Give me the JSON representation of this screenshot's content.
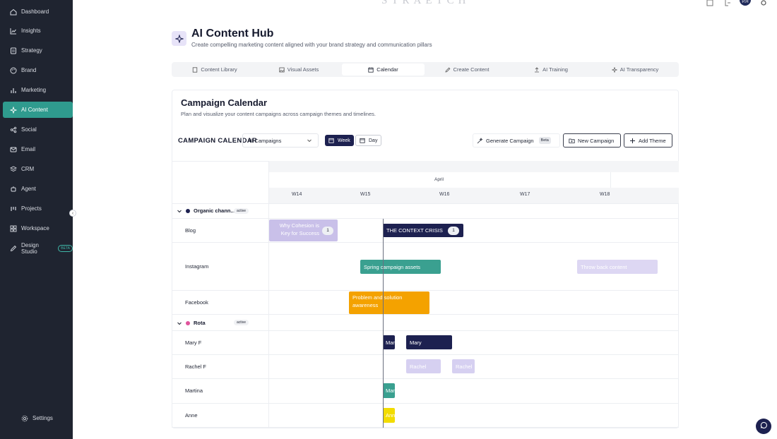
{
  "sidebar": {
    "items": [
      {
        "label": "Dashboard",
        "icon": "home-icon"
      },
      {
        "label": "Insights",
        "icon": "chart-line-icon"
      },
      {
        "label": "Strategy",
        "icon": "document-icon"
      },
      {
        "label": "Brand",
        "icon": "palette-icon"
      },
      {
        "label": "Marketing",
        "icon": "bar-chart-icon"
      },
      {
        "label": "AI Content",
        "icon": "sparkles-icon",
        "active": true
      },
      {
        "label": "Social",
        "icon": "share-icon"
      },
      {
        "label": "Email",
        "icon": "mail-icon"
      },
      {
        "label": "CRM",
        "icon": "crm-icon"
      },
      {
        "label": "Agent",
        "icon": "robot-icon"
      },
      {
        "label": "Projects",
        "icon": "projects-icon"
      },
      {
        "label": "Workspace",
        "icon": "grid-icon"
      },
      {
        "label": "Design Studio",
        "icon": "pen-icon",
        "badge": "BETA"
      }
    ],
    "settings_label": "Settings"
  },
  "topbar": {
    "brand": "STRAETCH",
    "avatar_initials": "P.H"
  },
  "header": {
    "title": "AI Content Hub",
    "subtitle": "Create compelling marketing content aligned with your brand strategy and communication pillars"
  },
  "tabs": [
    {
      "label": "Content Library",
      "icon": "file-icon"
    },
    {
      "label": "Visual Assets",
      "icon": "image-icon"
    },
    {
      "label": "Calendar",
      "icon": "calendar-icon",
      "active": true
    },
    {
      "label": "Create Content",
      "icon": "pencil-icon"
    },
    {
      "label": "AI Training",
      "icon": "upload-icon"
    },
    {
      "label": "AI Transparency",
      "icon": "sparkles-icon"
    }
  ],
  "card": {
    "title": "Campaign Calendar",
    "subtitle": "Plan and visualize your content campaigns across campaign themes and timelines."
  },
  "toolbar": {
    "label": "CAMPAIGN CALENDAR",
    "campaign_select": "All Campaigns",
    "week_label": "Week",
    "day_label": "Day",
    "generate_label": "Generate Campaign",
    "generate_badge": "Beta",
    "new_campaign_label": "New Campaign",
    "add_theme_label": "Add Theme"
  },
  "calendar": {
    "month": "April",
    "weeks": [
      "W14",
      "W15",
      "W16",
      "W17",
      "W18"
    ],
    "groups": [
      {
        "name": "Organic chann...",
        "status": "active",
        "color": "#1d2150",
        "rows": [
          "Blog",
          "Instagram",
          "Facebook"
        ]
      },
      {
        "name": "Rota",
        "status": "active",
        "color": "#e0539b",
        "rows": [
          "Mary F",
          "Rachel F",
          "Martina",
          "Anne"
        ]
      }
    ],
    "events": [
      {
        "row": "Blog",
        "title": "Why Cohesion is Key for Success",
        "count": "1",
        "color": "#c9c0e9"
      },
      {
        "row": "Blog",
        "title": "THE CONTEXT CRISIS",
        "count": "1",
        "color": "#1d2150"
      },
      {
        "row": "Instagram",
        "title": "Spring campaign assets",
        "color": "#3aa090"
      },
      {
        "row": "Instagram",
        "title": "Throw back content",
        "color": "#ddd7f3"
      },
      {
        "row": "Facebook",
        "title": "Problem and solution awareness",
        "color": "#f4a200"
      },
      {
        "row": "Mary F",
        "title": "Mary",
        "color": "#1d2150"
      },
      {
        "row": "Mary F",
        "title": "Mary",
        "color": "#1d2150"
      },
      {
        "row": "Rachel F",
        "title": "Rachel",
        "color": "#d6d0f1"
      },
      {
        "row": "Rachel F",
        "title": "Rachel",
        "color": "#d6d0f1"
      },
      {
        "row": "Martina",
        "title": "Martina",
        "color": "#3aa090"
      },
      {
        "row": "Anne",
        "title": "Anne",
        "color": "#f2dc00"
      }
    ]
  }
}
